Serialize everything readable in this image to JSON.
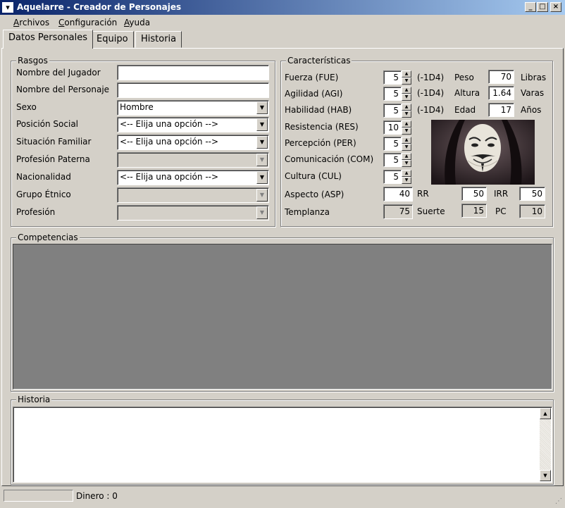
{
  "window": {
    "title": "Aquelarre - Creador de Personajes",
    "controls": {
      "minimize": "_",
      "maximize": "□",
      "close": "×"
    }
  },
  "menu": [
    "Archivos",
    "Configuración",
    "Ayuda"
  ],
  "tabs": [
    "Datos Personales",
    "Equipo",
    "Historia"
  ],
  "rasgos": {
    "title": "Rasgos",
    "nombre_jugador": {
      "label": "Nombre del Jugador",
      "value": ""
    },
    "nombre_personaje": {
      "label": "Nombre del Personaje",
      "value": ""
    },
    "sexo": {
      "label": "Sexo",
      "value": "Hombre"
    },
    "posicion_social": {
      "label": "Posición Social",
      "value": "<-- Elija una opción -->"
    },
    "situacion_familiar": {
      "label": "Situación Familiar",
      "value": "<-- Elija una opción -->"
    },
    "profesion_paterna": {
      "label": "Profesión Paterna",
      "value": ""
    },
    "nacionalidad": {
      "label": "Nacionalidad",
      "value": "<-- Elija una opción -->"
    },
    "grupo_etnico": {
      "label": "Grupo Étnico",
      "value": ""
    },
    "profesion": {
      "label": "Profesión",
      "value": ""
    }
  },
  "caracteristicas": {
    "title": "Características",
    "fuerza": {
      "label": "Fuerza (FUE)",
      "value": "5",
      "mod": "(-1D4)"
    },
    "agilidad": {
      "label": "Agilidad (AGI)",
      "value": "5",
      "mod": "(-1D4)"
    },
    "habilidad": {
      "label": "Habilidad (HAB)",
      "value": "5",
      "mod": "(-1D4)"
    },
    "resistencia": {
      "label": "Resistencia (RES)",
      "value": "10"
    },
    "percepcion": {
      "label": "Percepción (PER)",
      "value": "5"
    },
    "comunicacion": {
      "label": "Comunicación (COM)",
      "value": "5"
    },
    "cultura": {
      "label": "Cultura (CUL)",
      "value": "5"
    },
    "aspecto": {
      "label": "Aspecto (ASP)",
      "value": "40"
    },
    "templanza": {
      "label": "Templanza",
      "value": "75"
    },
    "peso": {
      "label": "Peso",
      "value": "70",
      "unit": "Libras"
    },
    "altura": {
      "label": "Altura",
      "value": "1.64",
      "unit": "Varas"
    },
    "edad": {
      "label": "Edad",
      "value": "17",
      "unit": "Años"
    },
    "rr": {
      "label": "RR",
      "value": "50"
    },
    "irr": {
      "label": "IRR",
      "value": "50"
    },
    "suerte": {
      "label": "Suerte",
      "value": "15"
    },
    "pc": {
      "label": "PC",
      "value": "10"
    }
  },
  "competencias": {
    "title": "Competencias"
  },
  "historia": {
    "title": "Historia",
    "text": ""
  },
  "status": {
    "dinero": "Dinero : 0"
  }
}
